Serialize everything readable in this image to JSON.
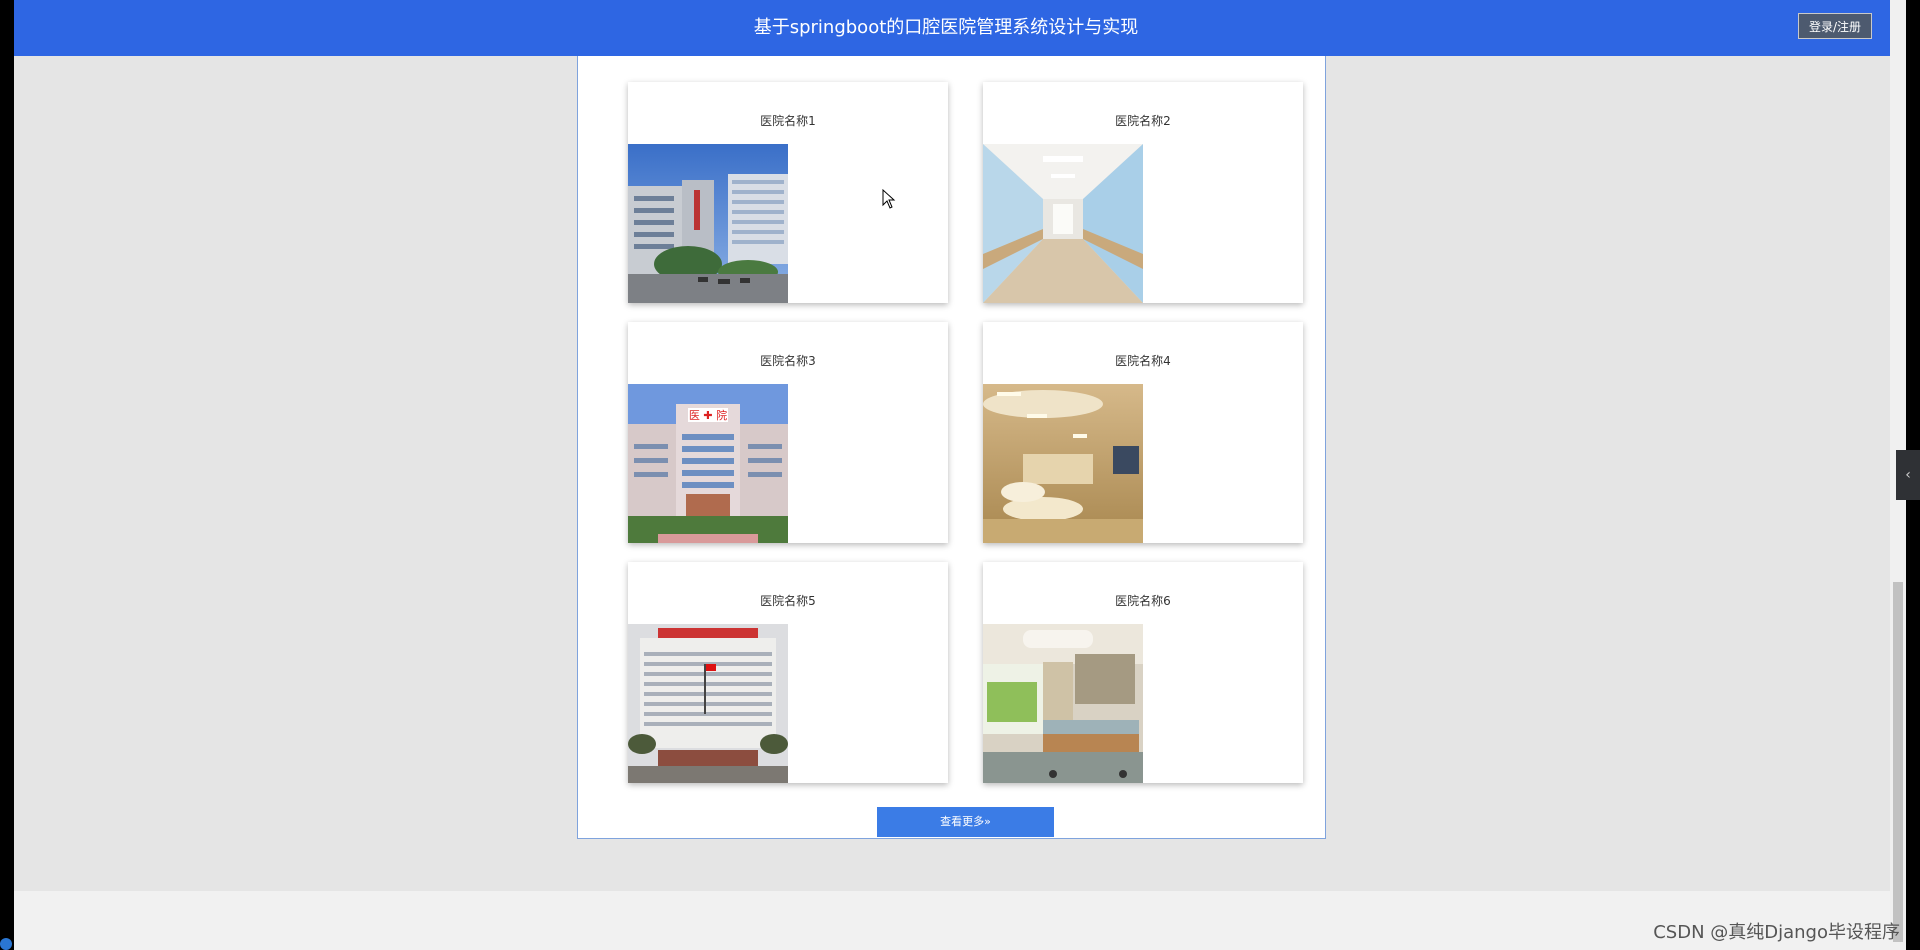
{
  "header": {
    "title": "基于springboot的口腔医院管理系统设计与实现",
    "login_label": "登录/注册"
  },
  "hospitals": [
    {
      "name": "医院名称1",
      "image": "hospital-building-photo"
    },
    {
      "name": "医院名称2",
      "image": "hospital-corridor-photo"
    },
    {
      "name": "医院名称3",
      "image": "hospital-facade-photo"
    },
    {
      "name": "医院名称4",
      "image": "hospital-lobby-photo"
    },
    {
      "name": "医院名称5",
      "image": "hospital-tower-photo"
    },
    {
      "name": "医院名称6",
      "image": "hospital-ward-photo"
    }
  ],
  "more_label": "查看更多»",
  "watermark": "CSDN @真纯Django毕设程序",
  "colors": {
    "header": "#2e66e3",
    "button": "#3b7ce6",
    "background": "#e5e5e5"
  }
}
